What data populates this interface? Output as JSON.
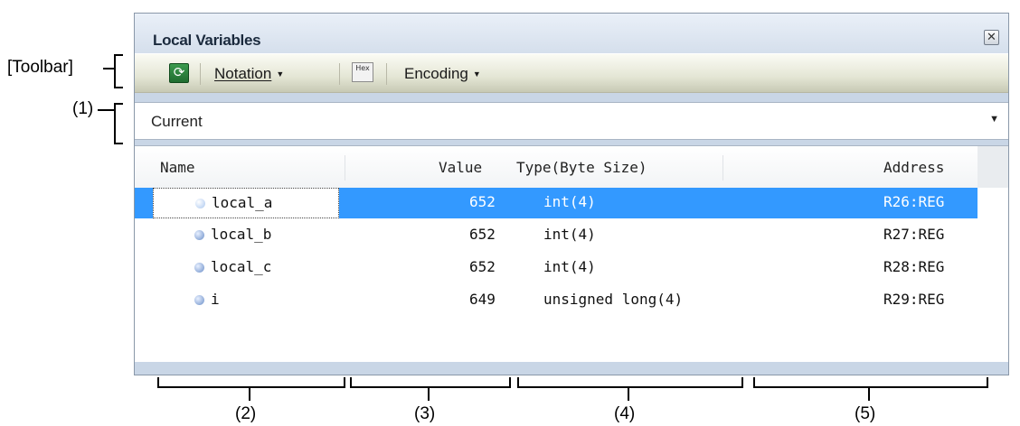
{
  "annotations": {
    "toolbar_label": "[Toolbar]",
    "combo_label": "(1)",
    "col_labels": [
      "(2)",
      "(3)",
      "(4)",
      "(5)"
    ]
  },
  "panel": {
    "title": "Local Variables",
    "close_glyph": "✕"
  },
  "toolbar": {
    "refresh_icon": "refresh-icon",
    "notation_label": "Notation",
    "hex_icon_text": "Hex",
    "encoding_label": "Encoding"
  },
  "scope_select": {
    "value": "Current"
  },
  "grid": {
    "columns": [
      "Name",
      "Value",
      "Type(Byte Size)",
      "Address"
    ],
    "rows": [
      {
        "name": "local_a",
        "value": "652",
        "type": "int(4)",
        "address": "R26:REG",
        "selected": true
      },
      {
        "name": "local_b",
        "value": "652",
        "type": "int(4)",
        "address": "R27:REG",
        "selected": false
      },
      {
        "name": "local_c",
        "value": "652",
        "type": "int(4)",
        "address": "R28:REG",
        "selected": false
      },
      {
        "name": "i",
        "value": "649",
        "type": "unsigned long(4)",
        "address": "R29:REG",
        "selected": false
      }
    ]
  },
  "colors": {
    "selection": "#3399ff",
    "toolbar_bg": "#e4e6d5",
    "panel_bg": "#c9d6e6"
  }
}
